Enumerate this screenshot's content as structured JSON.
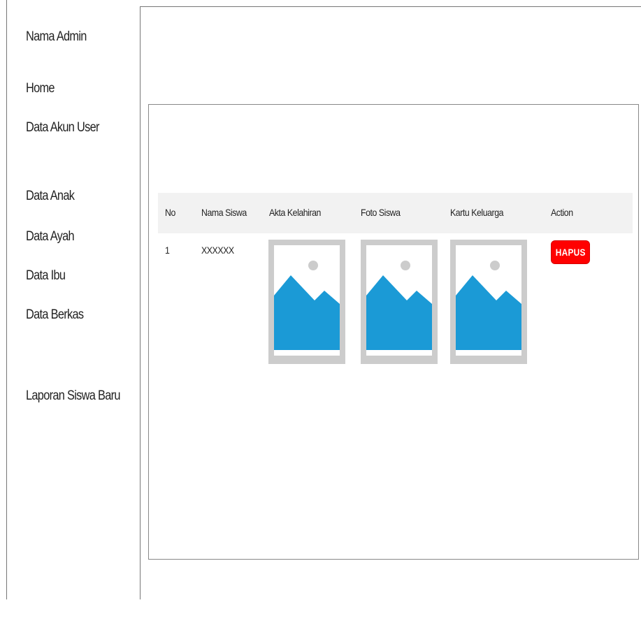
{
  "sidebar": {
    "admin_name": "Nama Admin",
    "items": [
      {
        "label": "Home"
      },
      {
        "label": "Data Akun User"
      },
      {
        "label": "Data Anak"
      },
      {
        "label": "Data Ayah"
      },
      {
        "label": "Data Ibu"
      },
      {
        "label": "Data Berkas"
      },
      {
        "label": "Laporan Siswa Baru"
      }
    ]
  },
  "table": {
    "headers": [
      "No",
      "Nama Siswa",
      "Akta Kelahiran",
      "Foto Siswa",
      "Kartu Keluarga",
      "Action"
    ],
    "rows": [
      {
        "no": "1",
        "nama": "XXXXXX",
        "akta_icon": "image-placeholder-icon",
        "foto_icon": "image-placeholder-icon",
        "kk_icon": "image-placeholder-icon",
        "action_label": "HAPUS"
      }
    ]
  },
  "colors": {
    "delete_button": "#ff0000",
    "placeholder_frame": "#cccccc",
    "placeholder_mountain": "#1b9ad6",
    "header_bg": "#f2f2f2"
  }
}
